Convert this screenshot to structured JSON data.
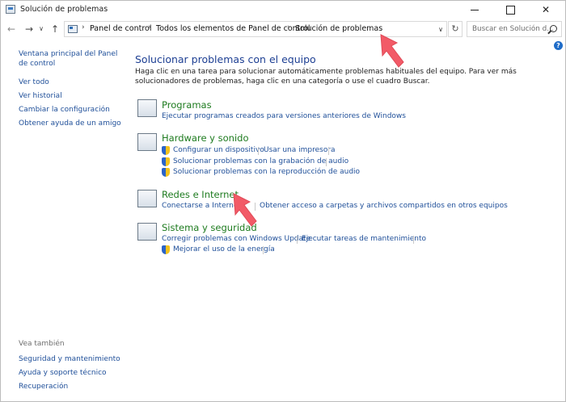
{
  "window": {
    "title": "Solución de problemas"
  },
  "address": {
    "crumbs": [
      "Panel de control",
      "Todos los elementos de Panel de control",
      "Solución de problemas"
    ]
  },
  "search": {
    "placeholder": "Buscar en Solución d..."
  },
  "leftnav": {
    "items": [
      {
        "label": "Ventana principal del Panel de control"
      },
      {
        "label": "Ver todo"
      },
      {
        "label": "Ver historial"
      },
      {
        "label": "Cambiar la configuración"
      },
      {
        "label": "Obtener ayuda de un amigo"
      }
    ],
    "see_also_label": "Vea también",
    "see_also": [
      {
        "label": "Seguridad y mantenimiento"
      },
      {
        "label": "Ayuda y soporte técnico"
      },
      {
        "label": "Recuperación"
      }
    ]
  },
  "main": {
    "title": "Solucionar problemas con el equipo",
    "description": "Haga clic en una tarea para solucionar automáticamente problemas habituales del equipo. Para ver más solucionadores de problemas, haga clic en una categoría o use el cuadro Buscar.",
    "categories": [
      {
        "title": "Programas",
        "icon": "programs-icon",
        "tasks": [
          "Ejecutar programas creados para versiones anteriores de Windows"
        ]
      },
      {
        "title": "Hardware y sonido",
        "icon": "hardware-sound-icon",
        "tasks": [
          "Configurar un dispositivo",
          "Usar una impresora",
          "Solucionar problemas con la grabación de audio",
          "Solucionar problemas con la reproducción de audio"
        ]
      },
      {
        "title": "Redes e Internet",
        "icon": "network-internet-icon",
        "tasks": [
          "Conectarse a Internet",
          "Obtener acceso a carpetas y archivos compartidos en otros equipos"
        ]
      },
      {
        "title": "Sistema y seguridad",
        "icon": "system-security-icon",
        "tasks": [
          "Corregir problemas con Windows Update",
          "Ejecutar tareas de mantenimiento",
          "Mejorar el uso de la energía"
        ]
      }
    ]
  },
  "colors": {
    "link": "#1f4f99",
    "category": "#1e7b1f",
    "heading": "#1d3f93",
    "annotation_arrow": "#f25a67"
  }
}
